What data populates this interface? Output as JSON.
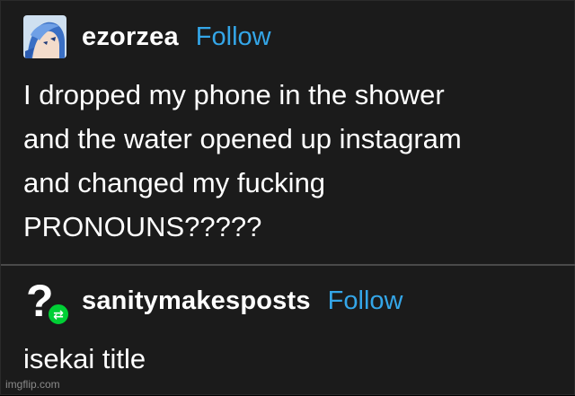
{
  "colors": {
    "background": "#1b1b1b",
    "text": "#ffffff",
    "follow": "#34a6e8",
    "reblog_badge": "#00cf35",
    "divider": "#4a4a4a"
  },
  "posts": [
    {
      "username": "ezorzea",
      "follow_label": "Follow",
      "avatar_icon": "anime-avatar-icon",
      "body": "I dropped my phone in the shower\nand the water opened up instagram\nand changed my fucking\nPRONOUNS?????"
    },
    {
      "username": "sanitymakesposts",
      "follow_label": "Follow",
      "avatar_icon": "question-mark-avatar-icon",
      "avatar_glyph": "?",
      "badge_icon": "reblog-icon",
      "badge_glyph": "⇄",
      "body": "isekai title"
    }
  ],
  "watermark": "imgflip.com"
}
